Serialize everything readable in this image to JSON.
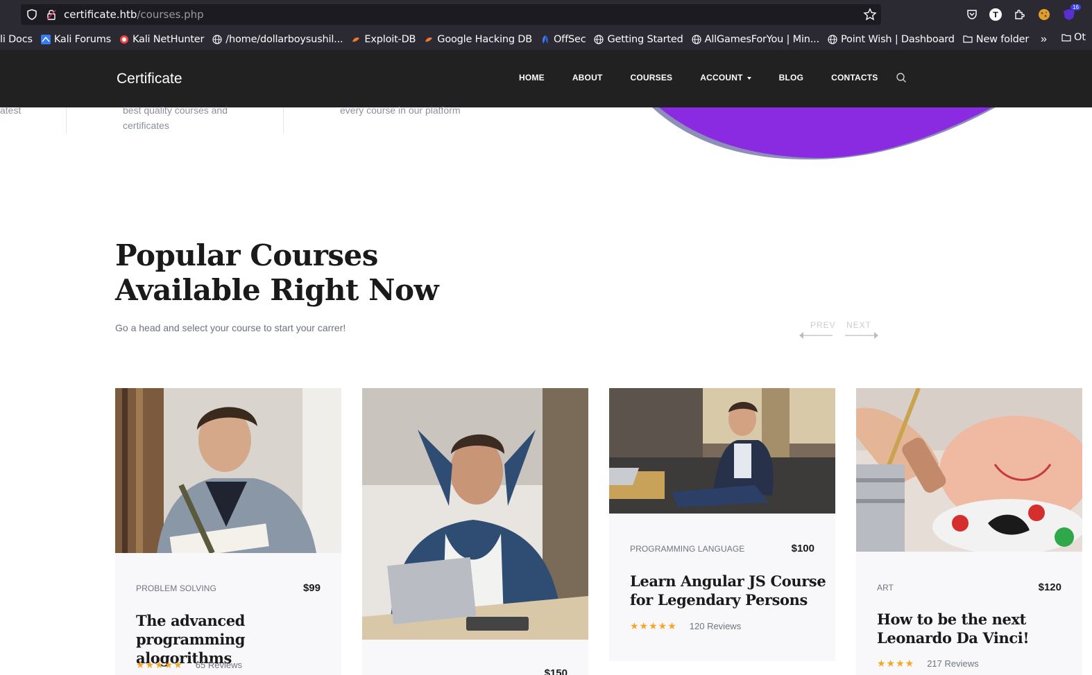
{
  "browser": {
    "url_host": "certificate.htb",
    "url_path": "/courses.php",
    "bookmarks": [
      {
        "label": "li Docs",
        "icon": "kali-icon"
      },
      {
        "label": "Kali Forums",
        "icon": "kali-icon"
      },
      {
        "label": "Kali NetHunter",
        "icon": "nethunter-icon"
      },
      {
        "label": "/home/dollarboysushil...",
        "icon": "globe-icon"
      },
      {
        "label": "Exploit-DB",
        "icon": "exploitdb-icon"
      },
      {
        "label": "Google Hacking DB",
        "icon": "exploitdb-icon"
      },
      {
        "label": "OffSec",
        "icon": "offsec-icon"
      },
      {
        "label": "Getting Started",
        "icon": "globe-icon"
      },
      {
        "label": "AllGamesForYou | Min...",
        "icon": "globe-icon"
      },
      {
        "label": "Point Wish | Dashboard",
        "icon": "globe-icon"
      },
      {
        "label": "New folder",
        "icon": "folder-icon"
      }
    ],
    "bookmarks_overflow_label": "Ot",
    "ext_badge": "16",
    "ext_t": "T"
  },
  "site": {
    "brand": "Certificate",
    "nav": {
      "home": "HOME",
      "about": "ABOUT",
      "courses": "COURSES",
      "account": "ACCOUNT",
      "blog": "BLOG",
      "contacts": "CONTACTS"
    }
  },
  "hero": {
    "col1": "atest",
    "col2_line1": "best quality courses and",
    "col2_line2": "certificates",
    "col3": "every course in our platform"
  },
  "popular": {
    "title_line1": "Popular Courses",
    "title_line2": "Available Right Now",
    "subtitle": "Go a head and select your course to start your carrer!",
    "prev": "PREV",
    "next": "NEXT"
  },
  "courses": [
    {
      "category": "PROBLEM SOLVING",
      "price": "$99",
      "title_line1": "The advanced",
      "title_line2": "programming alogorithms",
      "stars": "★★★★★",
      "reviews": "65 Reviews"
    },
    {
      "category": "",
      "price": "$150",
      "title_line1": "",
      "title_line2": "",
      "stars": "",
      "reviews": ""
    },
    {
      "category": "PROGRAMMING LANGUAGE",
      "price": "$100",
      "title_line1": "Learn Angular JS Course",
      "title_line2": "for Legendary Persons",
      "stars": "★★★★★",
      "reviews": "120 Reviews"
    },
    {
      "category": "ART",
      "price": "$120",
      "title_line1": "How to be the next",
      "title_line2": "Leonardo Da Vinci!",
      "stars": "★★★★",
      "reviews": "217 Reviews"
    }
  ],
  "colors": {
    "header_bg": "#212121",
    "blob_purple": "#8a2be2",
    "star": "#f5a623"
  }
}
